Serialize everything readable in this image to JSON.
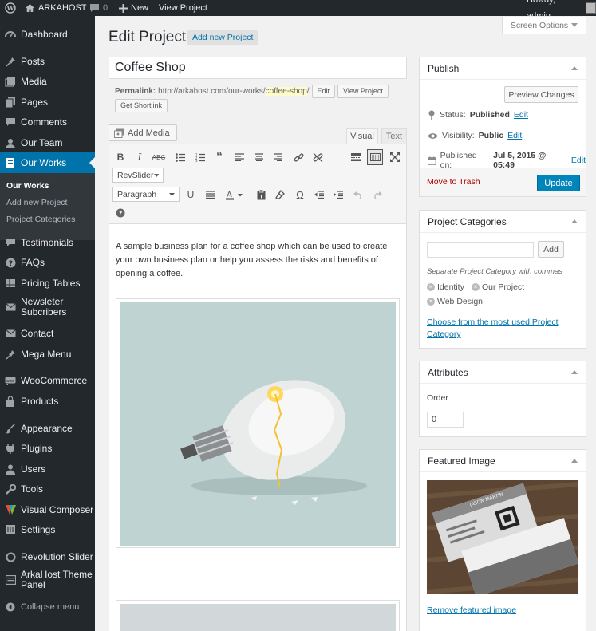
{
  "adminbar": {
    "site_name": "ARKAHOST",
    "comments_count": "0",
    "new_label": "New",
    "view_project": "View Project",
    "howdy": "Howdy, admin"
  },
  "sidebar": {
    "items": [
      {
        "label": "Dashboard",
        "icon": "dashboard-icon"
      },
      {
        "label": "Posts",
        "icon": "pin-icon"
      },
      {
        "label": "Media",
        "icon": "media-icon"
      },
      {
        "label": "Pages",
        "icon": "pages-icon"
      },
      {
        "label": "Comments",
        "icon": "comment-icon"
      },
      {
        "label": "Our Team",
        "icon": "team-icon"
      },
      {
        "label": "Our Works",
        "icon": "works-icon"
      },
      {
        "label": "Testimonials",
        "icon": "testimonial-icon"
      },
      {
        "label": "FAQs",
        "icon": "question-icon"
      },
      {
        "label": "Pricing Tables",
        "icon": "table-icon"
      },
      {
        "label": "Newsleter Subcribers",
        "icon": "mail-icon"
      },
      {
        "label": "Contact",
        "icon": "mail-icon"
      },
      {
        "label": "Mega Menu",
        "icon": "pin-icon"
      },
      {
        "label": "WooCommerce",
        "icon": "woo-icon"
      },
      {
        "label": "Products",
        "icon": "products-icon"
      },
      {
        "label": "Appearance",
        "icon": "brush-icon"
      },
      {
        "label": "Plugins",
        "icon": "plugin-icon"
      },
      {
        "label": "Users",
        "icon": "user-icon"
      },
      {
        "label": "Tools",
        "icon": "wrench-icon"
      },
      {
        "label": "Visual Composer",
        "icon": "vc-icon"
      },
      {
        "label": "Settings",
        "icon": "settings-icon"
      },
      {
        "label": "Revolution Slider",
        "icon": "refresh-icon"
      },
      {
        "label": "ArkaHost Theme Panel",
        "icon": "panel-icon"
      }
    ],
    "submenu": [
      "Our Works",
      "Add new Project",
      "Project Categories"
    ],
    "collapse": "Collapse menu"
  },
  "main": {
    "heading": "Edit Project",
    "add_new": "Add new Project",
    "screen_options": "Screen Options",
    "title_value": "Coffee Shop",
    "permalink_label": "Permalink:",
    "permalink_base": "http://arkahost.com/our-works/",
    "permalink_slug": "coffee-shop",
    "permalink_end": "/",
    "edit_btn": "Edit",
    "view_btn": "View Project",
    "shortlink_btn": "Get Shortlink",
    "add_media": "Add Media",
    "tab_visual": "Visual",
    "tab_text": "Text",
    "revslider": "RevSlider",
    "format_select": "Paragraph",
    "content_text": "A sample business plan for a coffee shop which can be used to create your own business plan or help you assess the risks and benefits of opening a coffee."
  },
  "publish": {
    "title": "Publish",
    "preview": "Preview Changes",
    "status_label": "Status:",
    "status_value": "Published",
    "visibility_label": "Visibility:",
    "visibility_value": "Public",
    "published_label": "Published on:",
    "published_value": "Jul 5, 2015 @ 05:49",
    "edit": "Edit",
    "trash": "Move to Trash",
    "update": "Update"
  },
  "categories": {
    "title": "Project Categories",
    "add_btn": "Add",
    "hint": "Separate Project Category with commas",
    "tags": [
      "Identity",
      "Our Project",
      "Web Design"
    ],
    "choose_link": "Choose from the most used Project Category"
  },
  "attributes": {
    "title": "Attributes",
    "order_label": "Order",
    "order_value": "0"
  },
  "featured": {
    "title": "Featured Image",
    "card_name": "JASON MARTIN",
    "remove": "Remove featured image"
  },
  "colors": {
    "sidebar_bg": "#23282d",
    "accent": "#0073aa",
    "primary_button": "#0085ba",
    "trash": "#a00"
  }
}
